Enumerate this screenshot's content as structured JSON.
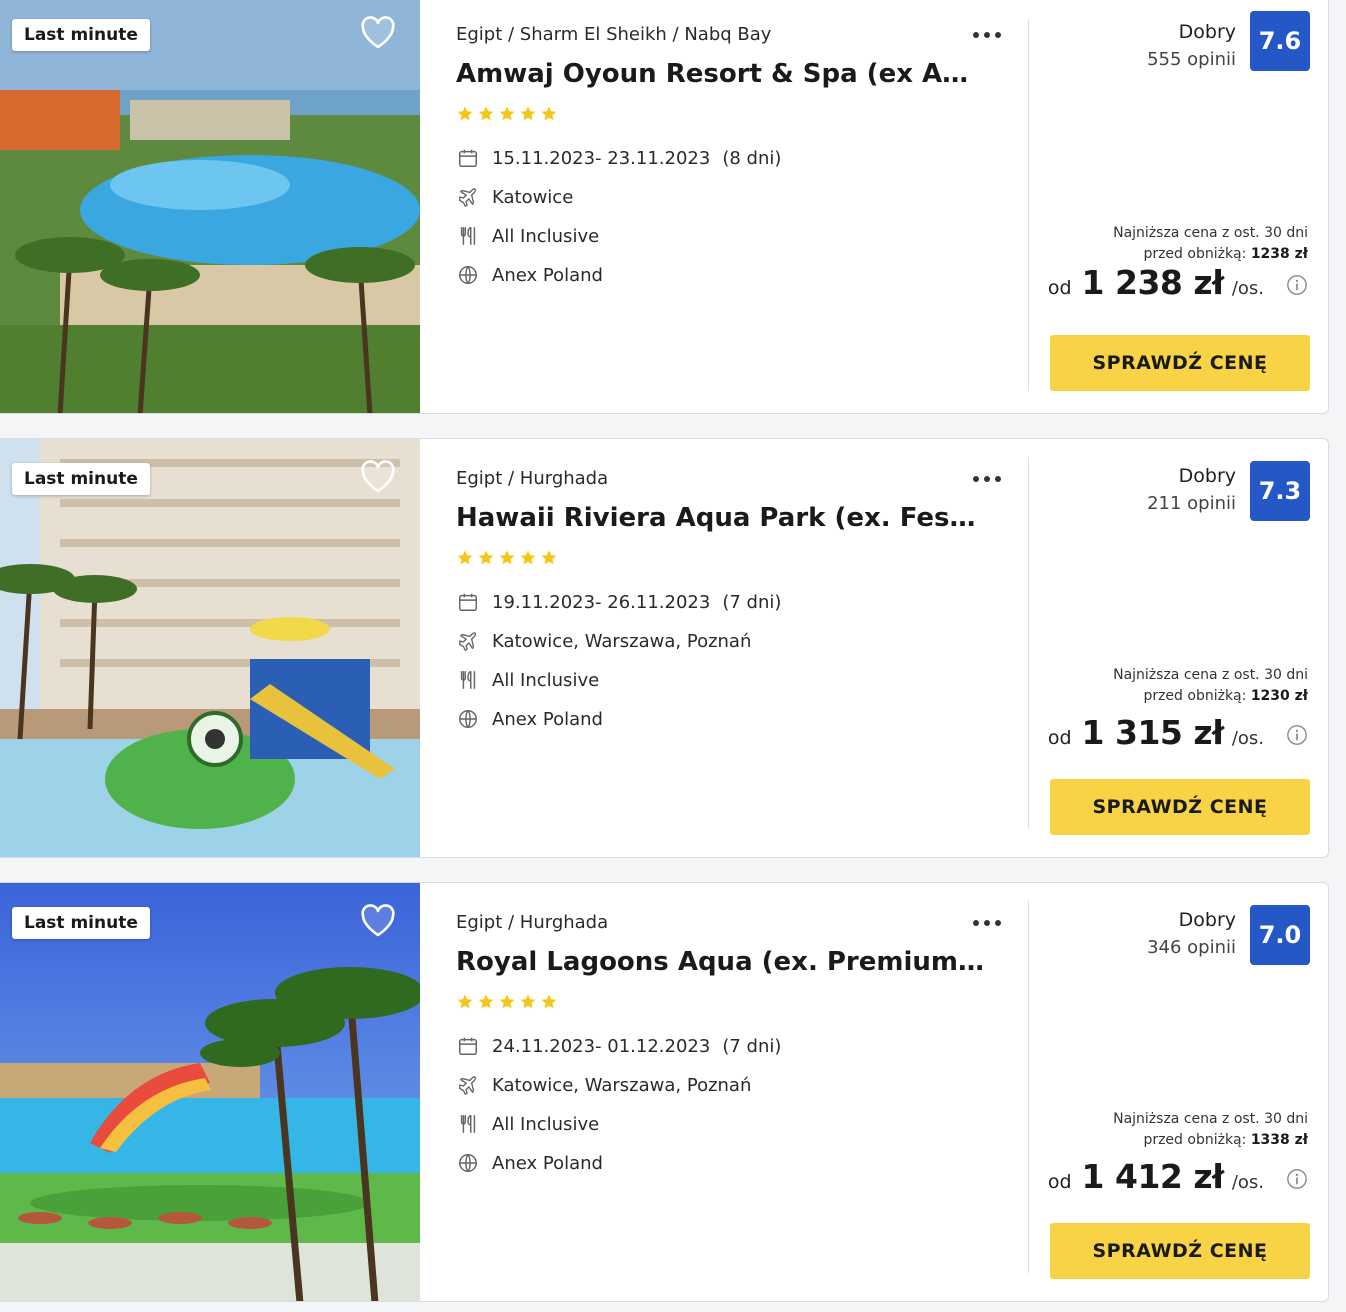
{
  "colors": {
    "accent": "#f7d345",
    "score_bg": "#2557c6",
    "stars": "#f5c518"
  },
  "offers": [
    {
      "badge": "Last minute",
      "location": "Egipt / Sharm El Sheikh / Nabq Bay",
      "title": "Amwaj Oyoun Resort & Spa (ex AA Amwaj Resort & Spa)",
      "stars": 5,
      "dates": "15.11.2023- 23.11.2023",
      "nights": "(8 dni)",
      "departure": "Katowice",
      "board": "All Inclusive",
      "operator": "Anex Poland",
      "rating_word": "Dobry",
      "rating_count": "555 opinii",
      "score": "7.6",
      "lowest_text": "Najniższa cena z ost. 30 dni",
      "lowest_before": "przed obniżką:",
      "lowest_value": "1238 zł",
      "price_prefix": "od",
      "price": "1 238 zł",
      "price_suffix": "/os.",
      "cta": "SPRAWDŹ CENĘ",
      "photo_theme": "resort-pool"
    },
    {
      "badge": "Last minute",
      "location": "Egipt / Hurghada",
      "title": "Hawaii Riviera Aqua Park (ex. Festival Riviera Resort)",
      "stars": 5,
      "dates": "19.11.2023- 26.11.2023",
      "nights": "(7 dni)",
      "departure": "Katowice, Warszawa, Poznań",
      "board": "All Inclusive",
      "operator": "Anex Poland",
      "rating_word": "Dobry",
      "rating_count": "211 opinii",
      "score": "7.3",
      "lowest_text": "Najniższa cena z ost. 30 dni",
      "lowest_before": "przed obniżką:",
      "lowest_value": "1230 zł",
      "price_prefix": "od",
      "price": "1 315 zł",
      "price_suffix": "/os.",
      "cta": "SPRAWDŹ CENĘ",
      "photo_theme": "hotel-aquapark"
    },
    {
      "badge": "Last minute",
      "location": "Egipt / Hurghada",
      "title": "Royal Lagoons Aqua (ex. Premium Blue Lagoon Resort)",
      "stars": 5,
      "dates": "24.11.2023- 01.12.2023",
      "nights": "(7 dni)",
      "departure": "Katowice, Warszawa, Poznań",
      "board": "All Inclusive",
      "operator": "Anex Poland",
      "rating_word": "Dobry",
      "rating_count": "346 opinii",
      "score": "7.0",
      "lowest_text": "Najniższa cena z ost. 30 dni",
      "lowest_before": "przed obniżką:",
      "lowest_value": "1338 zł",
      "price_prefix": "od",
      "price": "1 412 zł",
      "price_suffix": "/os.",
      "cta": "SPRAWDŹ CENĘ",
      "photo_theme": "palm-lagoon"
    }
  ]
}
